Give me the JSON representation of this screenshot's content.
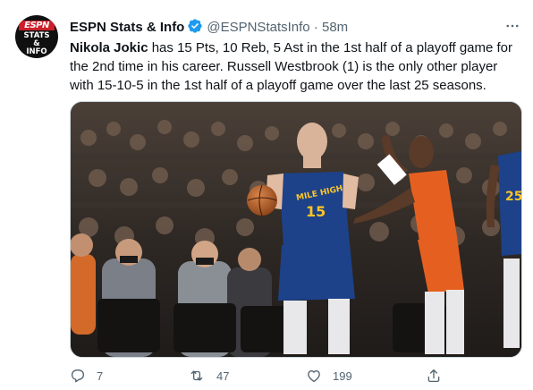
{
  "tweet": {
    "avatar": {
      "brand": "ESPN",
      "line1": "STATS",
      "line2": "&",
      "line3": "INFO",
      "color": "#cc1f2a"
    },
    "display_name": "ESPN Stats & Info",
    "handle": "@ESPNStatsInfo",
    "separator": "·",
    "time": "58m",
    "more_icon": "more-horizontal-icon",
    "text": {
      "bold_name": "Nikola Jokic",
      "body": " has 15 Pts, 10 Reb, 5 Ast in the 1st half of a playoff game for the 2nd time in his career. Russell Westbrook (1) is the only other player with 15-10-5 in the 1st half of a playoff game over the last 25 seasons."
    },
    "media": {
      "jersey_text": "MILE HIGH",
      "jersey_number": "15",
      "opponent_number": "25"
    },
    "actions": {
      "reply_count": "7",
      "retweet_count": "47",
      "like_count": "199"
    }
  },
  "colors": {
    "text": "#0f1419",
    "secondary": "#536471",
    "verified": "#1d9bf0",
    "border": "#cfd9de",
    "nuggets_blue": "#1d428a",
    "suns_orange": "#e56020"
  }
}
